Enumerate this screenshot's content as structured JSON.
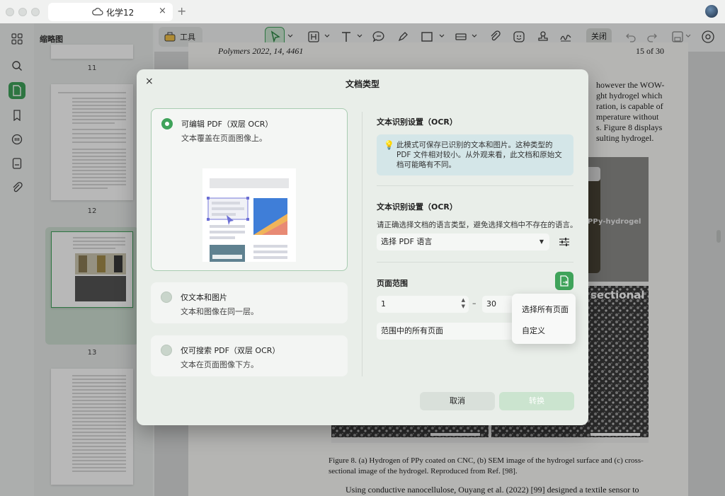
{
  "window": {
    "tab_title": "化学12",
    "tab_close": "×",
    "tab_add": "+"
  },
  "rail": {
    "items": [
      "thumbnails-grid-icon",
      "search-icon",
      "document-icon",
      "bookmark-icon",
      "comment-icon",
      "form-icon",
      "attachment-icon"
    ]
  },
  "thumbnails": {
    "title": "缩略图",
    "pages": [
      "11",
      "12",
      "13"
    ]
  },
  "toolbar": {
    "tools_label": "工具",
    "close_label": "关闭"
  },
  "document": {
    "header": "Polymers 2022, 14, 4461",
    "page_of": "15 of 30",
    "lines_right": [
      "however the WOW-",
      "ght hydrogel which",
      "ration, is capable of",
      "mperature without",
      "s. Figure 8 displays",
      "sulting  hydrogel."
    ],
    "figure_label_top": "PPy-hydrogel",
    "figure_label_cross": "sectional",
    "caption_1": "Figure 8. (a) Hydrogen of PPy coated on CNC, (b) SEM image of the hydrogel surface and (c) cross-",
    "caption_2": "sectional image of the hydrogel. Reproduced from Ref. [98].",
    "body_line": "Using conductive nanocellulose, Ouyang et al. (2022) [99] designed a textile sensor to"
  },
  "dialog": {
    "title": "文档类型",
    "close": "×",
    "options": [
      {
        "title": "可编辑 PDF（双层 OCR）",
        "desc": "文本覆盖在页面图像上。"
      },
      {
        "title": "仅文本和图片",
        "desc": "文本和图像在同一层。"
      },
      {
        "title": "仅可搜索 PDF（双层 OCR）",
        "desc": "文本在页面图像下方。"
      }
    ],
    "ocr_title_1": "文本识别设置（OCR）",
    "info_text": "此模式可保存已识别的文本和图片。这种类型的 PDF 文件相对较小。从外观来看，此文档和原始文档可能略有不同。",
    "ocr_title_2": "文本识别设置（OCR）",
    "lang_desc": "请正确选择文档的语言类型，避免选择文档中不存在的语言。",
    "lang_select": "选择 PDF 语言",
    "page_range_title": "页面范围",
    "range_from": "1",
    "range_dash": "–",
    "range_to": "30",
    "range_select": "范围中的所有页面",
    "popup_items": [
      "选择所有页面",
      "自定义"
    ],
    "cancel": "取消",
    "convert": "转换"
  },
  "colors": {
    "accent": "#3fa35a"
  }
}
